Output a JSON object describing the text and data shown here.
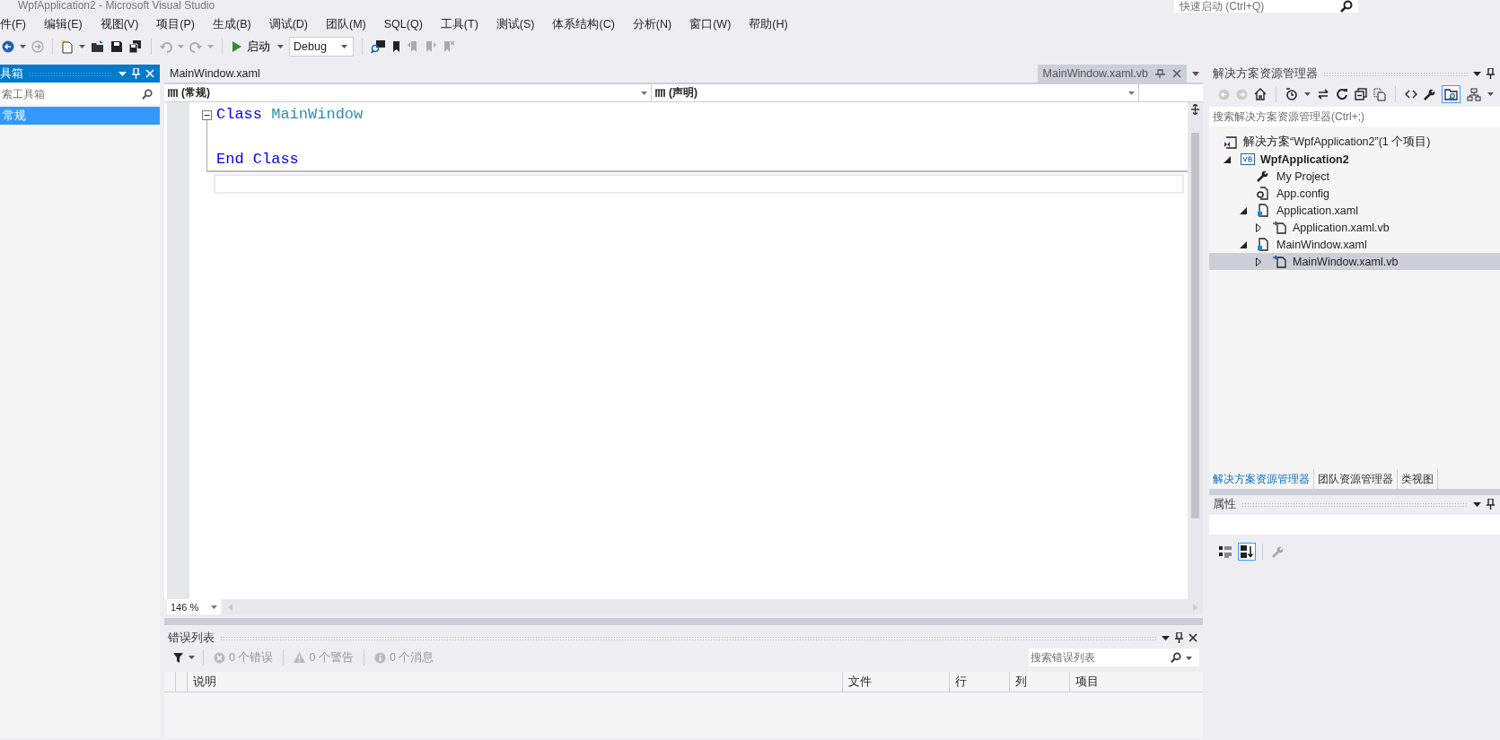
{
  "window": {
    "title": "WpfApplication2 - Microsoft Visual Studio"
  },
  "quick_launch": {
    "placeholder": "快速启动 (Ctrl+Q)"
  },
  "menu": [
    "件(F)",
    "编辑(E)",
    "视图(V)",
    "项目(P)",
    "生成(B)",
    "调试(D)",
    "团队(M)",
    "SQL(Q)",
    "工具(T)",
    "测试(S)",
    "体系结构(C)",
    "分析(N)",
    "窗口(W)",
    "帮助(H)"
  ],
  "toolbar": {
    "start_button": "启动",
    "configuration": "Debug"
  },
  "toolbox": {
    "title": "具箱",
    "search": {
      "placeholder": "索工具箱"
    },
    "groups": [
      {
        "label": "常规",
        "selected": true
      }
    ]
  },
  "editor": {
    "tabs": [
      {
        "label": "MainWindow.xaml",
        "selected": false
      },
      {
        "label": "MainWindow.xaml.vb",
        "selected": true
      }
    ],
    "type_dropdown": "(常规)",
    "member_dropdown": "(声明)",
    "lines": [
      {
        "kind": "code",
        "tokens": [
          {
            "kind": "keyword",
            "text": "Class"
          },
          {
            "kind": "type",
            "text": "MainWindow"
          }
        ]
      },
      {
        "kind": "blank"
      },
      {
        "kind": "code",
        "tokens": [
          {
            "kind": "keyword",
            "text": "End"
          },
          {
            "kind": "keyword",
            "text": "Class"
          }
        ]
      }
    ],
    "zoom": "146 %"
  },
  "error_list": {
    "title": "错误列表",
    "filters": [
      "0 个错误",
      "0 个警告",
      "0 个消息"
    ],
    "search": {
      "placeholder": "搜索错误列表"
    },
    "columns": [
      "说明",
      "文件",
      "行",
      "列",
      "项目"
    ]
  },
  "solution_explorer": {
    "title": "解决方案资源管理器",
    "search": {
      "placeholder": "搜索解决方案资源管理器(Ctrl+;)"
    },
    "tree": [
      {
        "label": "解决方案“WpfApplication2”(1 个项目)",
        "kind": "solution",
        "selected": false,
        "children": [
          {
            "label": "WpfApplication2",
            "kind": "project",
            "expanded": true,
            "selected": false,
            "children": [
              {
                "label": "My Project",
                "kind": "settings",
                "selected": false
              },
              {
                "label": "App.config",
                "kind": "config",
                "selected": false
              },
              {
                "label": "Application.xaml",
                "kind": "xaml",
                "expanded": true,
                "selected": false,
                "children": [
                  {
                    "label": "Application.xaml.vb",
                    "kind": "code",
                    "expanded": false,
                    "selected": false
                  }
                ]
              },
              {
                "label": "MainWindow.xaml",
                "kind": "xaml",
                "expanded": true,
                "selected": false,
                "children": [
                  {
                    "label": "MainWindow.xaml.vb",
                    "kind": "code",
                    "expanded": false,
                    "selected": true
                  }
                ]
              }
            ]
          }
        ]
      }
    ],
    "bottom_tabs": [
      {
        "label": "解决方案资源管理器",
        "selected": true
      },
      {
        "label": "团队资源管理器",
        "selected": false
      },
      {
        "label": "类视图",
        "selected": false
      }
    ]
  },
  "properties": {
    "title": "属性",
    "tools": [
      {
        "kind": "categorized",
        "selected": false,
        "disabled": false
      },
      {
        "kind": "alphabetical",
        "selected": true,
        "disabled": false
      },
      {
        "kind": "pages",
        "selected": false,
        "disabled": true
      }
    ]
  }
}
